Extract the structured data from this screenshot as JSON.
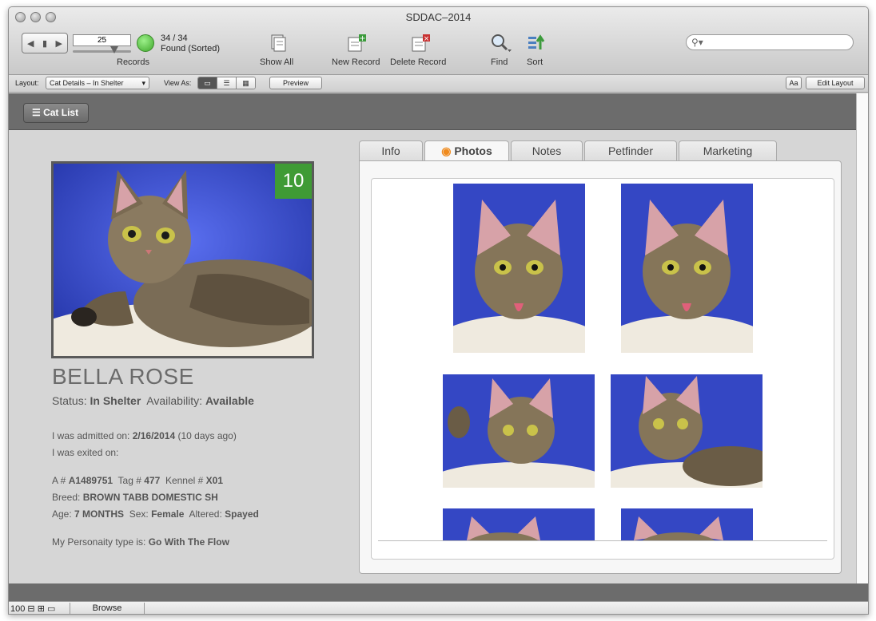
{
  "window": {
    "title": "SDDAC–2014"
  },
  "toolbar": {
    "record_value": "25",
    "records_label": "Records",
    "count": "34 / 34",
    "found": "Found (Sorted)",
    "show_all": "Show All",
    "new_record": "New Record",
    "delete_record": "Delete Record",
    "find": "Find",
    "sort": "Sort",
    "search_icon": "search-icon"
  },
  "layoutbar": {
    "layout_label": "Layout:",
    "layout_value": "Cat Details – In Shelter",
    "view_as_label": "View As:",
    "preview": "Preview",
    "aa": "Aa",
    "edit_layout": "Edit Layout"
  },
  "header": {
    "cat_list": "Cat List"
  },
  "cat": {
    "badge": "10",
    "name": "BELLA ROSE",
    "status_label": "Status:",
    "status_value": "In Shelter",
    "availability_label": "Availability:",
    "availability_value": "Available",
    "admitted_label": "I was admitted on:",
    "admitted_date": "2/16/2014",
    "admitted_ago": "(10 days ago)",
    "exited_label": "I was exited on:",
    "a_label": "A #",
    "a_value": "A1489751",
    "tag_label": "Tag #",
    "tag_value": "477",
    "kennel_label": "Kennel #",
    "kennel_value": "X01",
    "breed_label": "Breed:",
    "breed_value": "BROWN TABB DOMESTIC SH",
    "age_label": "Age:",
    "age_value": "7 MONTHS",
    "sex_label": "Sex:",
    "sex_value": "Female",
    "altered_label": "Altered:",
    "altered_value": "Spayed",
    "personality_label": "My Personaity type is:",
    "personality_value": "Go With The Flow"
  },
  "tabs": [
    {
      "label": "Info"
    },
    {
      "label": "Photos"
    },
    {
      "label": "Notes"
    },
    {
      "label": "Petfinder"
    },
    {
      "label": "Marketing"
    }
  ],
  "bottombar": {
    "zoom": "100",
    "mode": "Browse"
  },
  "colors": {
    "badge": "#3f9b35",
    "header": "#6c6c6c",
    "photo_bg": "#3a4fd0"
  }
}
